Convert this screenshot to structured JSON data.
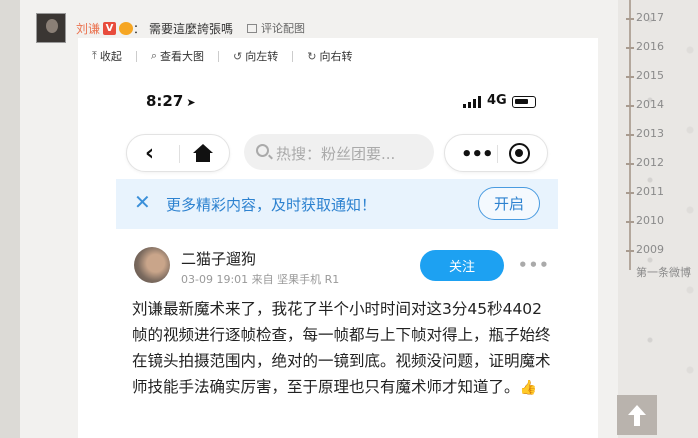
{
  "post": {
    "username": "刘谦",
    "v_badge": "V",
    "text": "需要這麼誇張嗎",
    "comment_pic_label": "评论配图"
  },
  "viewer": {
    "toolbar": {
      "collapse": "收起",
      "view_large": "查看大图",
      "rotate_left": "向左转",
      "rotate_right": "向右转"
    }
  },
  "phone": {
    "time": "8:27",
    "network": "4G",
    "search_placeholder": "热搜：粉丝团要...",
    "notify_text": "更多精彩内容，及时获取通知！",
    "open_button": "开启",
    "author_name": "二猫子遛狗",
    "author_meta": "03-09 19:01  来自 坚果手机 R1",
    "follow_button": "关注",
    "body_text": "刘谦最新魔术来了，我花了半个小时时间对这3分45秒4402帧的视频进行逐帧检查，每一帧都与上下帧对得上，瓶子始终在镜头拍摄范围内，绝对的一镜到底。视频没问题，证明魔术师技能手法确实厉害，至于原理也只有魔术师才知道了。"
  },
  "years": [
    "2017",
    "2016",
    "2015",
    "2014",
    "2013",
    "2012",
    "2011",
    "2010",
    "2009"
  ],
  "first_weibo": "第一条微博"
}
